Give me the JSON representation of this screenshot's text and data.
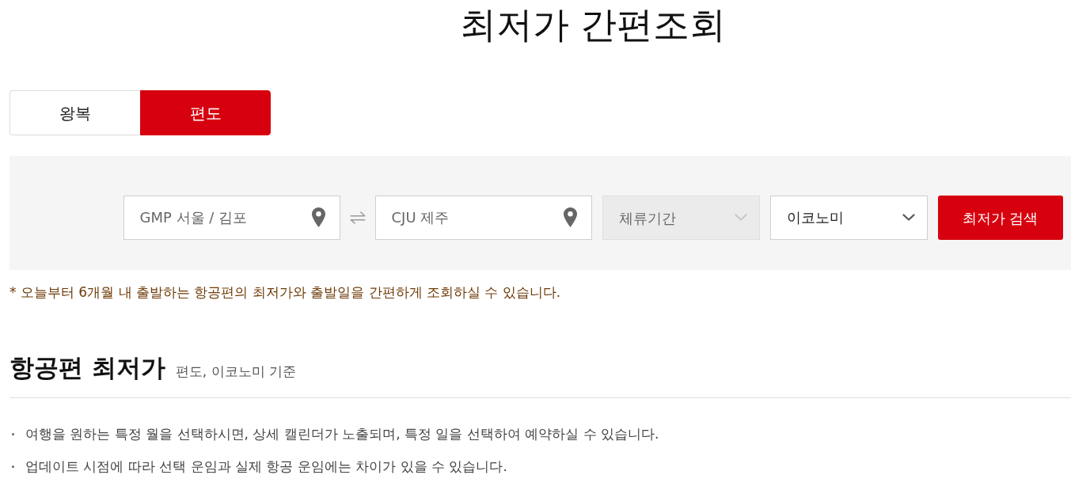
{
  "page_title": "최저가 간편조회",
  "trip_tabs": [
    {
      "label": "왕복",
      "selected": false
    },
    {
      "label": "편도",
      "selected": true
    }
  ],
  "search_form": {
    "origin": {
      "value": "GMP 서울 / 김포"
    },
    "destination": {
      "value": "CJU 제주"
    },
    "stay_period": {
      "placeholder": "체류기간",
      "disabled": true
    },
    "cabin": {
      "value": "이코노미"
    },
    "search_button": "최저가 검색"
  },
  "notice": "* 오늘부터 6개월 내 출발하는 항공편의 최저가와 출발일을 간편하게 조회하실 수 있습니다.",
  "section": {
    "title": "항공편 최저가",
    "subtitle": "편도, 이코노미 기준"
  },
  "bullets": [
    "여행을 원하는 특정 월을 선택하시면, 상세 캘린더가 노출되며, 특정 일을 선택하여 예약하실 수 있습니다.",
    "업데이트 시점에 따라 선택 운임과 실제 항공 운임에는 차이가 있을 수 있습니다."
  ]
}
